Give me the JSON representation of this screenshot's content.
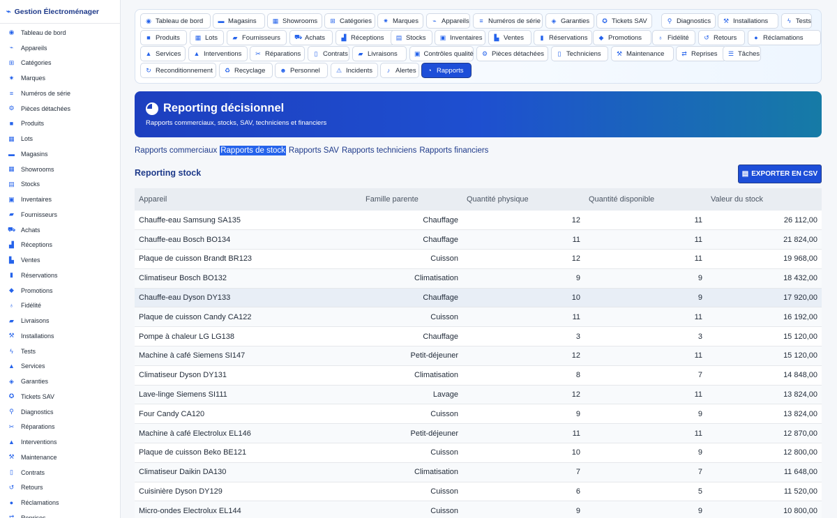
{
  "app": {
    "title": "Gestion Électroménager"
  },
  "sidebar": {
    "items": [
      {
        "label": "Tableau de bord",
        "icon": "dashboard-icon",
        "glyph": "◉"
      },
      {
        "label": "Appareils",
        "icon": "plug-icon",
        "glyph": "⌁"
      },
      {
        "label": "Catégories",
        "icon": "sitemap-icon",
        "glyph": "⊞"
      },
      {
        "label": "Marques",
        "icon": "badge-icon",
        "glyph": "✷"
      },
      {
        "label": "Numéros de série",
        "icon": "barcode-icon",
        "glyph": "≡"
      },
      {
        "label": "Pièces détachées",
        "icon": "cog-icon",
        "glyph": "⚙"
      },
      {
        "label": "Produits",
        "icon": "boxes-icon",
        "glyph": "■"
      },
      {
        "label": "Lots",
        "icon": "layers-icon",
        "glyph": "▦"
      },
      {
        "label": "Magasins",
        "icon": "store-icon",
        "glyph": "▬"
      },
      {
        "label": "Showrooms",
        "icon": "grid-icon",
        "glyph": "▦"
      },
      {
        "label": "Stocks",
        "icon": "warehouse-icon",
        "glyph": "▤"
      },
      {
        "label": "Inventaires",
        "icon": "clipboard-icon",
        "glyph": "▣"
      },
      {
        "label": "Fournisseurs",
        "icon": "truck-icon",
        "glyph": "▰"
      },
      {
        "label": "Achats",
        "icon": "cart-icon",
        "glyph": "⛟"
      },
      {
        "label": "Réceptions",
        "icon": "dolly-icon",
        "glyph": "▟"
      },
      {
        "label": "Ventes",
        "icon": "cash-register-icon",
        "glyph": "▙"
      },
      {
        "label": "Réservations",
        "icon": "bookmark-icon",
        "glyph": "▮"
      },
      {
        "label": "Promotions",
        "icon": "tags-icon",
        "glyph": "◆"
      },
      {
        "label": "Fidélité",
        "icon": "award-icon",
        "glyph": "♁"
      },
      {
        "label": "Livraisons",
        "icon": "shipping-icon",
        "glyph": "▰"
      },
      {
        "label": "Installations",
        "icon": "wrench-icon",
        "glyph": "⚒"
      },
      {
        "label": "Tests",
        "icon": "bolt-icon",
        "glyph": "ϟ"
      },
      {
        "label": "Services",
        "icon": "bell-concierge-icon",
        "glyph": "▲"
      },
      {
        "label": "Garanties",
        "icon": "shield-icon",
        "glyph": "◈"
      },
      {
        "label": "Tickets SAV",
        "icon": "lifebuoy-icon",
        "glyph": "✪"
      },
      {
        "label": "Diagnostics",
        "icon": "search-icon",
        "glyph": "⚲"
      },
      {
        "label": "Réparations",
        "icon": "tools-icon",
        "glyph": "✂"
      },
      {
        "label": "Interventions",
        "icon": "helmet-icon",
        "glyph": "▲"
      },
      {
        "label": "Maintenance",
        "icon": "hammer-icon",
        "glyph": "⚒"
      },
      {
        "label": "Contrats",
        "icon": "file-contract-icon",
        "glyph": "▯"
      },
      {
        "label": "Retours",
        "icon": "undo-icon",
        "glyph": "↺"
      },
      {
        "label": "Réclamations",
        "icon": "comment-icon",
        "glyph": "●"
      },
      {
        "label": "Reprises",
        "icon": "exchange-icon",
        "glyph": "⇄"
      }
    ]
  },
  "nav": {
    "rows": [
      [
        {
          "label": "Tableau de bord",
          "glyph": "◉",
          "icon": "dashboard-icon"
        },
        {
          "label": "Magasins",
          "glyph": "▬",
          "icon": "store-icon"
        },
        {
          "label": "Showrooms",
          "glyph": "▦",
          "icon": "grid-icon"
        },
        {
          "label": "Catégories",
          "glyph": "⊞",
          "icon": "sitemap-icon"
        },
        {
          "label": "Marques",
          "glyph": "✷",
          "icon": "badge-icon"
        },
        {
          "label": "Appareils",
          "glyph": "⌁",
          "icon": "plug-icon"
        },
        {
          "label": "Numéros de série",
          "glyph": "≡",
          "icon": "barcode-icon"
        },
        {
          "label": "Garanties",
          "glyph": "◈",
          "icon": "shield-icon"
        },
        {
          "label": "Tickets SAV",
          "glyph": "✪",
          "icon": "lifebuoy-icon"
        },
        {
          "label": "Diagnostics",
          "glyph": "⚲",
          "icon": "search-icon"
        },
        {
          "label": "Installations",
          "glyph": "⚒",
          "icon": "wrench-icon"
        },
        {
          "label": "Tests",
          "glyph": "ϟ",
          "icon": "bolt-icon"
        }
      ],
      [
        {
          "label": "Produits",
          "glyph": "■",
          "icon": "boxes-icon"
        },
        {
          "label": "Lots",
          "glyph": "▦",
          "icon": "layers-icon"
        },
        {
          "label": "Fournisseurs",
          "glyph": "▰",
          "icon": "truck-icon"
        },
        {
          "label": "Achats",
          "glyph": "⛟",
          "icon": "cart-icon"
        },
        {
          "label": "Réceptions",
          "glyph": "▟",
          "icon": "dolly-icon"
        },
        {
          "label": "Stocks",
          "glyph": "▤",
          "icon": "warehouse-icon"
        },
        {
          "label": "Inventaires",
          "glyph": "▣",
          "icon": "clipboard-icon"
        },
        {
          "label": "Ventes",
          "glyph": "▙",
          "icon": "cash-register-icon"
        },
        {
          "label": "Réservations",
          "glyph": "▮",
          "icon": "bookmark-icon"
        },
        {
          "label": "Promotions",
          "glyph": "◆",
          "icon": "tags-icon"
        },
        {
          "label": "Fidélité",
          "glyph": "♁",
          "icon": "award-icon"
        },
        {
          "label": "Retours",
          "glyph": "↺",
          "icon": "undo-icon"
        },
        {
          "label": "Réclamations",
          "glyph": "●",
          "icon": "comment-icon"
        }
      ],
      [
        {
          "label": "Services",
          "glyph": "▲",
          "icon": "bell-concierge-icon"
        },
        {
          "label": "Interventions",
          "glyph": "▲",
          "icon": "helmet-icon"
        },
        {
          "label": "Réparations",
          "glyph": "✂",
          "icon": "tools-icon"
        },
        {
          "label": "Contrats",
          "glyph": "▯",
          "icon": "file-contract-icon"
        },
        {
          "label": "Livraisons",
          "glyph": "▰",
          "icon": "shipping-icon"
        },
        {
          "label": "Contrôles qualité",
          "glyph": "▣",
          "icon": "clipboard-check-icon"
        },
        {
          "label": "Pièces détachées",
          "glyph": "⚙",
          "icon": "cog-icon"
        },
        {
          "label": "Techniciens",
          "glyph": "▯",
          "icon": "id-badge-icon"
        },
        {
          "label": "Maintenance",
          "glyph": "⚒",
          "icon": "hammer-icon"
        },
        {
          "label": "Reprises",
          "glyph": "⇄",
          "icon": "exchange-icon"
        },
        {
          "label": "Tâches",
          "glyph": "☰",
          "icon": "list-icon"
        }
      ],
      [
        {
          "label": "Reconditionnement",
          "glyph": "↻",
          "icon": "refresh-icon"
        },
        {
          "label": "Recyclage",
          "glyph": "♻",
          "icon": "recycle-icon"
        },
        {
          "label": "Personnel",
          "glyph": "☻",
          "icon": "users-icon"
        },
        {
          "label": "Incidents",
          "glyph": "⚠",
          "icon": "warning-icon"
        },
        {
          "label": "Alertes",
          "glyph": "♪",
          "icon": "bell-icon"
        },
        {
          "label": "Rapports",
          "glyph": "◔",
          "icon": "pie-chart-icon",
          "active": true
        }
      ]
    ]
  },
  "hero": {
    "title": "Reporting décisionnel",
    "subtitle": "Rapports commerciaux, stocks, SAV, techniciens et financiers"
  },
  "tabs": [
    {
      "label": "Rapports commerciaux"
    },
    {
      "label": "Rapports de stock",
      "active": true
    },
    {
      "label": "Rapports SAV"
    },
    {
      "label": "Rapports techniciens"
    },
    {
      "label": "Rapports financiers"
    }
  ],
  "section": {
    "title": "Reporting stock",
    "export_label": "EXPORTER EN CSV"
  },
  "table": {
    "headers": [
      "Appareil",
      "Famille parente",
      "Quantité physique",
      "Quantité disponible",
      "Valeur du stock"
    ],
    "rows": [
      [
        "Chauffe-eau Samsung SA135",
        "Chauffage",
        "12",
        "11",
        "26 112,00"
      ],
      [
        "Chauffe-eau Bosch BO134",
        "Chauffage",
        "11",
        "11",
        "21 824,00"
      ],
      [
        "Plaque de cuisson Brandt BR123",
        "Cuisson",
        "12",
        "11",
        "19 968,00"
      ],
      [
        "Climatiseur Bosch BO132",
        "Climatisation",
        "9",
        "9",
        "18 432,00"
      ],
      [
        "Chauffe-eau Dyson DY133",
        "Chauffage",
        "10",
        "9",
        "17 920,00"
      ],
      [
        "Plaque de cuisson Candy CA122",
        "Cuisson",
        "11",
        "11",
        "16 192,00"
      ],
      [
        "Pompe à chaleur LG LG138",
        "Chauffage",
        "3",
        "3",
        "15 120,00"
      ],
      [
        "Machine à café Siemens SI147",
        "Petit-déjeuner",
        "12",
        "11",
        "15 120,00"
      ],
      [
        "Climatiseur Dyson DY131",
        "Climatisation",
        "8",
        "7",
        "14 848,00"
      ],
      [
        "Lave-linge Siemens SI111",
        "Lavage",
        "12",
        "11",
        "13 824,00"
      ],
      [
        "Four Candy CA120",
        "Cuisson",
        "9",
        "9",
        "13 824,00"
      ],
      [
        "Machine à café Electrolux EL146",
        "Petit-déjeuner",
        "11",
        "11",
        "12 870,00"
      ],
      [
        "Plaque de cuisson Beko BE121",
        "Cuisson",
        "10",
        "9",
        "12 800,00"
      ],
      [
        "Climatiseur Daikin DA130",
        "Climatisation",
        "7",
        "7",
        "11 648,00"
      ],
      [
        "Cuisinière Dyson DY129",
        "Cuisson",
        "6",
        "5",
        "11 520,00"
      ],
      [
        "Micro-ondes Electrolux EL144",
        "Cuisson",
        "9",
        "9",
        "10 800,00"
      ]
    ]
  }
}
